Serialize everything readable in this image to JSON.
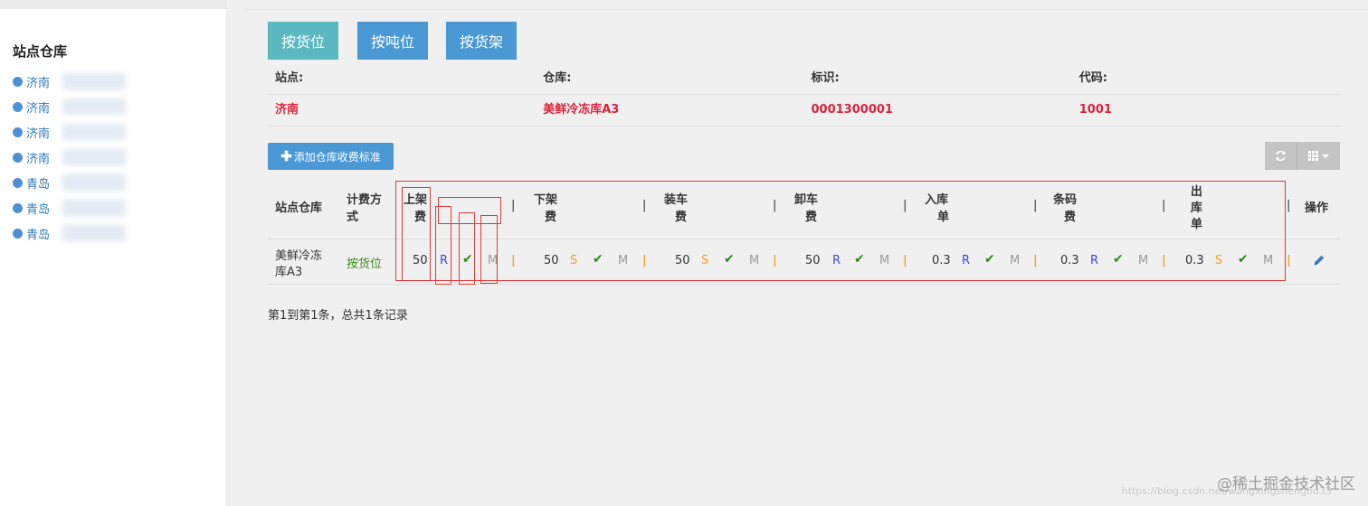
{
  "sidebar": {
    "title": "站点仓库",
    "items": [
      {
        "label": "济南"
      },
      {
        "label": "济南"
      },
      {
        "label": "济南"
      },
      {
        "label": "济南"
      },
      {
        "label": "青岛"
      },
      {
        "label": "青岛"
      },
      {
        "label": "青岛"
      }
    ]
  },
  "mode_buttons": {
    "by_slot": "按货位",
    "by_ton": "按吨位",
    "by_shelf": "按货架"
  },
  "info": {
    "headers": {
      "site": "站点:",
      "warehouse": "仓库:",
      "mark": "标识:",
      "code": "代码:"
    },
    "values": {
      "site": "济南",
      "warehouse": "美鲜冷冻库A3",
      "mark": "0001300001",
      "code": "1001"
    }
  },
  "toolbar": {
    "add_label": "添加仓库收费标准",
    "refresh_icon": "refresh-icon",
    "columns_icon": "grid-icon"
  },
  "table": {
    "headers": {
      "site_warehouse": "站点仓库",
      "billing_1": "计费方",
      "billing_2": "式",
      "up_1": "上架",
      "up_2": "费",
      "down_1": "下架",
      "down_2": "费",
      "load_1": "装车",
      "load_2": "费",
      "unload_1": "卸车",
      "unload_2": "费",
      "in_1": "入库",
      "in_2": "单",
      "barcode_1": "条码",
      "barcode_2": "费",
      "out_1": "出",
      "out_2": "库",
      "out_3": "单",
      "ops": "操作",
      "sep": "|"
    },
    "row": {
      "site_warehouse_1": "美鲜冷冻",
      "site_warehouse_2": "库A3",
      "billing": "按货位",
      "up": {
        "value": "50",
        "letter": "R",
        "check": "✔",
        "m": "M"
      },
      "down": {
        "value": "50",
        "letter": "S",
        "check": "✔",
        "m": "M"
      },
      "load": {
        "value": "50",
        "letter": "S",
        "check": "✔",
        "m": "M"
      },
      "unload": {
        "value": "50",
        "letter": "R",
        "check": "✔",
        "m": "M"
      },
      "in": {
        "value": "0.3",
        "letter": "R",
        "check": "✔",
        "m": "M"
      },
      "barcode": {
        "value": "0.3",
        "letter": "R",
        "check": "✔",
        "m": "M"
      },
      "out": {
        "value": "0.3",
        "letter": "S",
        "check": "✔",
        "m": "M"
      },
      "sep": "|",
      "edit_icon": "pencil-icon"
    }
  },
  "pager": {
    "text": "第1到第1条，总共1条记录"
  },
  "watermark": {
    "brand": "@稀土掘金技术社区",
    "url": "https://blog.csdn.net/wangxingshengbu33"
  },
  "colors": {
    "teal": "#5ab8c0",
    "blue": "#4a98d4",
    "red_value": "#d9243c",
    "annotation_box": "#e23a3a"
  }
}
